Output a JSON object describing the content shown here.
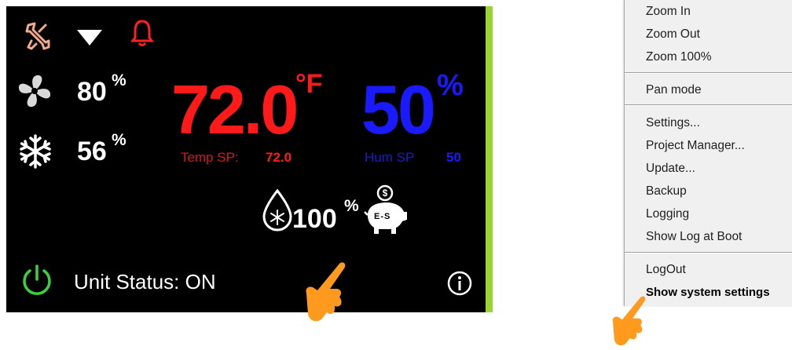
{
  "hmi": {
    "fan_percent": "80",
    "cool_percent": "56",
    "percent_symbol": "%",
    "temperature": "72.0",
    "temperature_unit": "°F",
    "humidity": "50",
    "humidity_unit": "%",
    "temp_sp_label": "Temp SP:",
    "temp_sp_value": "72.0",
    "hum_sp_label": "Hum SP",
    "hum_sp_value": "50",
    "dewpoint_percent": "100",
    "econ_label": "E-S",
    "unit_status": "Unit Status:  ON",
    "colors": {
      "temp": "#ff1a1a",
      "humidity": "#1a1aff",
      "power": "#3ad13a",
      "wrench": "#f4a98b",
      "alarm": "#ff2020",
      "accent_bar": "#9ad431"
    }
  },
  "menu": {
    "items": [
      {
        "label": "Zoom In"
      },
      {
        "label": "Zoom Out"
      },
      {
        "label": "Zoom 100%"
      },
      {
        "label": "Pan mode"
      },
      {
        "label": "Settings..."
      },
      {
        "label": "Project Manager..."
      },
      {
        "label": "Update..."
      },
      {
        "label": "Backup"
      },
      {
        "label": "Logging"
      },
      {
        "label": "Show Log at Boot"
      },
      {
        "label": "LogOut"
      },
      {
        "label": "Show system settings"
      }
    ]
  }
}
